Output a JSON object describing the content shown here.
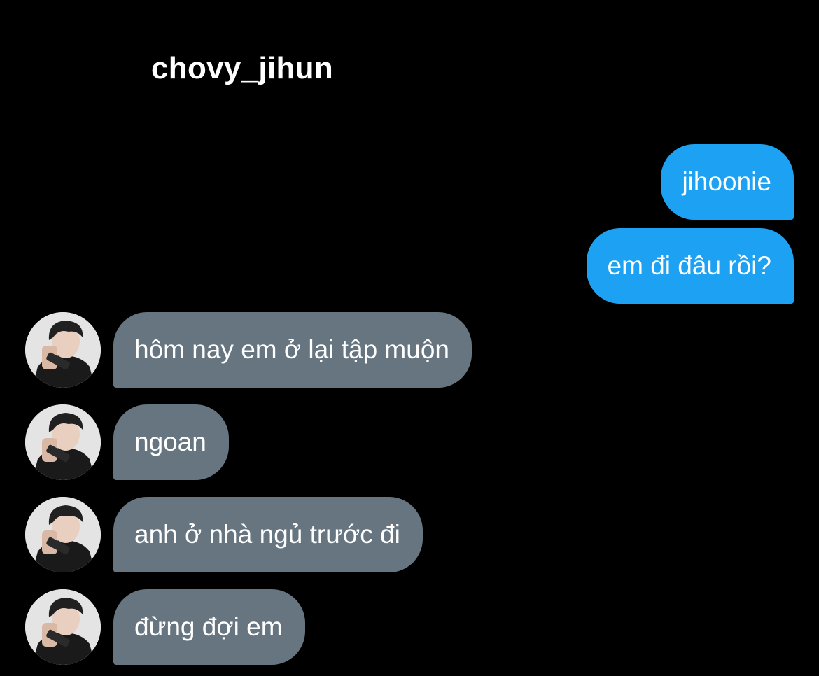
{
  "header": {
    "title": "chovy_jihun"
  },
  "colors": {
    "outgoing_bubble": "#1da1f2",
    "incoming_bubble": "#66757f",
    "background": "#000000",
    "text": "#ffffff"
  },
  "messages": [
    {
      "direction": "outgoing",
      "text": "jihoonie"
    },
    {
      "direction": "outgoing",
      "text": "em đi đâu rồi?"
    },
    {
      "direction": "incoming",
      "text": "hôm nay em ở lại tập muộn",
      "avatar": "user-avatar"
    },
    {
      "direction": "incoming",
      "text": "ngoan",
      "avatar": "user-avatar"
    },
    {
      "direction": "incoming",
      "text": "anh ở nhà ngủ trước đi",
      "avatar": "user-avatar"
    },
    {
      "direction": "incoming",
      "text": "đừng đợi em",
      "avatar": "user-avatar"
    }
  ]
}
